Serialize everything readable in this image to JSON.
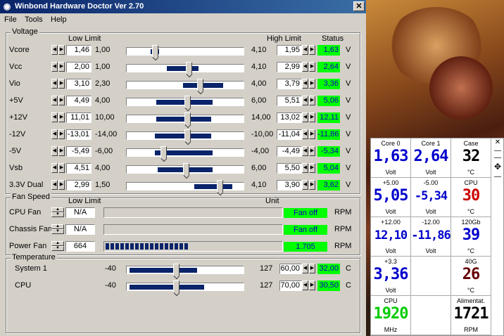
{
  "title": "Winbond Hardware Doctor Ver 2.70",
  "menu": [
    "File",
    "Tools",
    "Help"
  ],
  "voltage": {
    "group_title": "Voltage",
    "header_low": "Low Limit",
    "header_high": "High Limit",
    "header_status": "Status",
    "rows": [
      {
        "label": "Vcore",
        "low": "1,46",
        "low_min": "1,00",
        "high_max": "4,10",
        "high": "1,95",
        "status": "1,63",
        "unit": "V"
      },
      {
        "label": "Vcc",
        "low": "2,00",
        "low_min": "1,00",
        "high_max": "4,10",
        "high": "2,99",
        "status": "2,64",
        "unit": "V"
      },
      {
        "label": "Vio",
        "low": "3,10",
        "low_min": "2,30",
        "high_max": "4,00",
        "high": "3,79",
        "status": "3,36",
        "unit": "V"
      },
      {
        "label": "+5V",
        "low": "4,49",
        "low_min": "4,00",
        "high_max": "6,00",
        "high": "5,51",
        "status": "5,06",
        "unit": "V"
      },
      {
        "label": "+12V",
        "low": "11,01",
        "low_min": "10,00",
        "high_max": "14,00",
        "high": "13,02",
        "status": "12,11",
        "unit": "V"
      },
      {
        "label": "-12V",
        "low": "-13,01",
        "low_min": "-14,00",
        "high_max": "-10,00",
        "high": "-11,04",
        "status": "-11,86",
        "unit": "V"
      },
      {
        "label": "-5V",
        "low": "-5,49",
        "low_min": "-6,00",
        "high_max": "-4,00",
        "high": "-4,49",
        "status": "-5,34",
        "unit": "V"
      },
      {
        "label": "Vsb",
        "low": "4,51",
        "low_min": "4,00",
        "high_max": "6,00",
        "high": "5,50",
        "status": "5,04",
        "unit": "V"
      },
      {
        "label": "3.3V Dual",
        "low": "2,99",
        "low_min": "1,50",
        "high_max": "4,10",
        "high": "3,90",
        "status": "3,62",
        "unit": "V"
      }
    ]
  },
  "fan": {
    "group_title": "Fan Speed",
    "header_low": "Low Limit",
    "header_unit": "Unit",
    "rows": [
      {
        "label": "CPU Fan",
        "low": "N/A",
        "status": "Fan off",
        "unit": "RPM",
        "level": 0
      },
      {
        "label": "Chassis Fan",
        "low": "N/A",
        "status": "Fan off",
        "unit": "RPM",
        "level": 0
      },
      {
        "label": "Power Fan",
        "low": "664",
        "status": "1.705",
        "unit": "RPM",
        "level": 0.68
      }
    ]
  },
  "temperature": {
    "group_title": "Temperature",
    "rows": [
      {
        "label": "System 1",
        "low_min": "-40",
        "high_max": "127",
        "high": "60,00",
        "status": "32,00",
        "unit": "C"
      },
      {
        "label": "CPU",
        "low_min": "-40",
        "high_max": "127",
        "high": "70,00",
        "status": "30,50",
        "unit": "C"
      }
    ]
  },
  "gadget": {
    "cells": [
      {
        "title": "Core 0",
        "value": "1,63",
        "unit": "Volt",
        "color": "#0000cc"
      },
      {
        "title": "Core 1",
        "value": "2,64",
        "unit": "Volt",
        "color": "#0000cc"
      },
      {
        "title": "Case",
        "value": "32",
        "unit": "°C",
        "color": "#000000"
      },
      {
        "title": "+5.00",
        "value": "5,05",
        "unit": "Volt",
        "color": "#0000cc"
      },
      {
        "title": "-5.00",
        "value": "-5,34",
        "unit": "Volt",
        "color": "#0000cc"
      },
      {
        "title": "CPU",
        "value": "30",
        "unit": "°C",
        "color": "#cc0000"
      },
      {
        "title": "+12.00",
        "value": "12,10",
        "unit": "Volt",
        "color": "#0000cc"
      },
      {
        "title": "-12.00",
        "value": "-11,86",
        "unit": "Volt",
        "color": "#0000cc"
      },
      {
        "title": "120Gb",
        "value": "39",
        "unit": "°C",
        "color": "#0000cc"
      },
      {
        "title": "+3.3",
        "value": "3,36",
        "unit": "Volt",
        "color": "#0000cc"
      },
      {
        "title": "",
        "value": "",
        "unit": "",
        "color": "#000000"
      },
      {
        "title": "40G",
        "value": "26",
        "unit": "°C",
        "color": "#660000"
      },
      {
        "title": "CPU",
        "value": "1920",
        "unit": "MHz",
        "color": "#00cc00"
      },
      {
        "title": "",
        "value": "",
        "unit": "",
        "color": "#000000"
      },
      {
        "title": "Alimentat.",
        "value": "1721",
        "unit": "RPM",
        "color": "#000000"
      }
    ]
  }
}
